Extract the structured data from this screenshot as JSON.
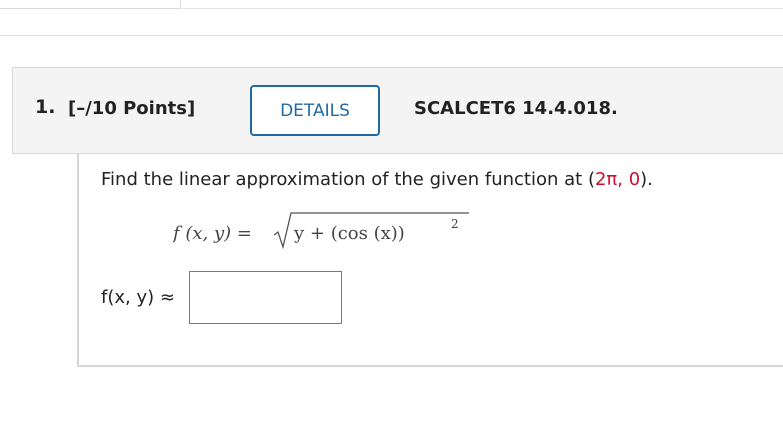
{
  "question": {
    "number": "1.",
    "points": "[–/10 Points]",
    "details_label": "DETAILS",
    "code": "SCALCET6 14.4.018."
  },
  "prompt": {
    "text_before": "Find the linear approximation of the given function at (",
    "point": "2π, 0",
    "text_after": ")."
  },
  "formula": {
    "lhs": "f (x, y) =",
    "radicand": "y + (cos (x))",
    "exponent": "2"
  },
  "answer": {
    "label": "f(x, y) ≈",
    "value": ""
  },
  "colors": {
    "accent": "#1f6aa5",
    "highlight": "#c8102e",
    "header_bg": "#f4f4f4"
  }
}
